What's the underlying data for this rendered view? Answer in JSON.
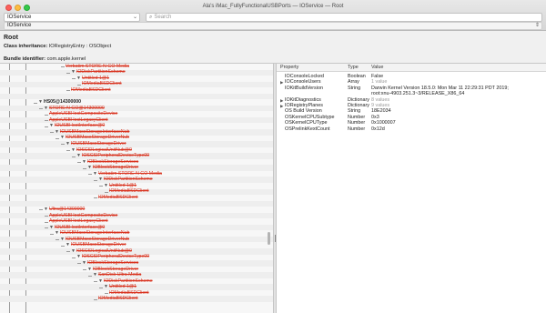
{
  "window": {
    "title": "Ala's iMac_FullyFunctionalUSBPorts — IOService — Root"
  },
  "toolbar": {
    "class_select": "IOService",
    "search_placeholder": "Search",
    "path_select": "IOService"
  },
  "info": {
    "name": "Root",
    "class_inheritance_label": "Class inheritance:",
    "class_inheritance_value": "IORegistryEntry : OSObject",
    "bundle_label": "Bundle identifier:",
    "bundle_value": "com.apple.kernel"
  },
  "tree": [
    {
      "label": "Verbatim STORE N GO Media",
      "depth": 7,
      "tri": "",
      "state": "removed"
    },
    {
      "label": "IODiskPartitionScheme",
      "depth": 8,
      "tri": "▼",
      "state": "removed"
    },
    {
      "label": "Untitled 1@1",
      "depth": 9,
      "tri": "▼",
      "state": "removed"
    },
    {
      "label": "IOMediaBSDClient",
      "depth": 10,
      "tri": "",
      "state": "removed"
    },
    {
      "label": "IOMediaBSDClient",
      "depth": 8,
      "tri": "",
      "state": "removed"
    },
    {
      "label": "",
      "depth": 0,
      "tri": "",
      "state": "blank"
    },
    {
      "label": "HS05@14300000",
      "depth": 2,
      "tri": "▼",
      "state": "ok"
    },
    {
      "label": "STORE N GO@14300000",
      "depth": 3,
      "tri": "▼",
      "state": "removed"
    },
    {
      "label": "AppleUSBHostCompositeDevice",
      "depth": 4,
      "tri": "",
      "state": "removed"
    },
    {
      "label": "AppleUSBHostLegacyClient",
      "depth": 4,
      "tri": "",
      "state": "removed"
    },
    {
      "label": "IOUSBHostInterface@0",
      "depth": 4,
      "tri": "▼",
      "state": "removed"
    },
    {
      "label": "IOUSBMassStorageInterfaceNub",
      "depth": 5,
      "tri": "▼",
      "state": "removed"
    },
    {
      "label": "IOUSBMassStorageDriverNub",
      "depth": 6,
      "tri": "▼",
      "state": "removed"
    },
    {
      "label": "IOUSBMassStorageDriver",
      "depth": 7,
      "tri": "▼",
      "state": "removed"
    },
    {
      "label": "IOSCSILogicalUnitNub@0",
      "depth": 8,
      "tri": "▼",
      "state": "removed"
    },
    {
      "label": "IOSCSIPeripheralDeviceType00",
      "depth": 9,
      "tri": "▼",
      "state": "removed"
    },
    {
      "label": "IOBlockStorageServices",
      "depth": 10,
      "tri": "▼",
      "state": "removed"
    },
    {
      "label": "IOBlockStorageDriver",
      "depth": 11,
      "tri": "▼",
      "state": "removed"
    },
    {
      "label": "Verbatim STORE N GO Media",
      "depth": 12,
      "tri": "▼",
      "state": "removed"
    },
    {
      "label": "IODiskPartitionScheme",
      "depth": 13,
      "tri": "▼",
      "state": "removed"
    },
    {
      "label": "Untitled 1@1",
      "depth": 14,
      "tri": "▼",
      "state": "removed"
    },
    {
      "label": "IOMediaBSDClient",
      "depth": 15,
      "tri": "",
      "state": "removed"
    },
    {
      "label": "IOMediaBSDClient",
      "depth": 13,
      "tri": "",
      "state": "removed"
    },
    {
      "label": "",
      "depth": 0,
      "tri": "",
      "state": "blank"
    },
    {
      "label": "Ultra@14300000",
      "depth": 3,
      "tri": "▼",
      "state": "removed"
    },
    {
      "label": "AppleUSBHostCompositeDevice",
      "depth": 4,
      "tri": "",
      "state": "removed"
    },
    {
      "label": "AppleUSBHostLegacyClient",
      "depth": 4,
      "tri": "",
      "state": "removed"
    },
    {
      "label": "IOUSBHostInterface@0",
      "depth": 4,
      "tri": "▼",
      "state": "removed"
    },
    {
      "label": "IOUSBMassStorageInterfaceNub",
      "depth": 5,
      "tri": "▼",
      "state": "removed"
    },
    {
      "label": "IOUSBMassStorageDriverNub",
      "depth": 6,
      "tri": "▼",
      "state": "removed"
    },
    {
      "label": "IOUSBMassStorageDriver",
      "depth": 7,
      "tri": "▼",
      "state": "removed"
    },
    {
      "label": "IOSCSILogicalUnitNub@0",
      "depth": 8,
      "tri": "▼",
      "state": "removed"
    },
    {
      "label": "IOSCSIPeripheralDeviceType00",
      "depth": 9,
      "tri": "▼",
      "state": "removed"
    },
    {
      "label": "IOBlockStorageServices",
      "depth": 10,
      "tri": "▼",
      "state": "removed"
    },
    {
      "label": "IOBlockStorageDriver",
      "depth": 11,
      "tri": "▼",
      "state": "removed"
    },
    {
      "label": "SanDisk Ultra Media",
      "depth": 12,
      "tri": "▼",
      "state": "removed"
    },
    {
      "label": "IODiskPartitionScheme",
      "depth": 13,
      "tri": "▼",
      "state": "removed"
    },
    {
      "label": "Untitled 1@1",
      "depth": 14,
      "tri": "▼",
      "state": "removed"
    },
    {
      "label": "IOMediaBSDClient",
      "depth": 15,
      "tri": "",
      "state": "removed"
    },
    {
      "label": "IOMediaBSDClient",
      "depth": 13,
      "tri": "",
      "state": "removed"
    }
  ],
  "properties": {
    "headers": {
      "property": "Property",
      "type": "Type",
      "value": "Value"
    },
    "rows": [
      {
        "key": "IOConsoleLocked",
        "type": "Boolean",
        "value": "False",
        "tri": "",
        "dim": false
      },
      {
        "key": "IOConsoleUsers",
        "type": "Array",
        "value": "1 value",
        "tri": "▶",
        "dim": true
      },
      {
        "key": "IOKitBuildVersion",
        "type": "String",
        "value": "Darwin Kernel Version 18.5.0: Mon Mar 11 22:29:31 PDT 2019;",
        "tri": "",
        "dim": false
      },
      {
        "key": "",
        "type": "",
        "value": "root:xnu-4903.251.3~3/RELEASE_X86_64",
        "tri": "",
        "dim": false
      },
      {
        "key": "IOKitDiagnostics",
        "type": "Dictionary",
        "value": "8 values",
        "tri": "▶",
        "dim": true
      },
      {
        "key": "IORegistryPlanes",
        "type": "Dictionary",
        "value": "9 values",
        "tri": "▶",
        "dim": true
      },
      {
        "key": "OS Build Version",
        "type": "String",
        "value": "18E2034",
        "tri": "",
        "dim": false
      },
      {
        "key": "OSKernelCPUSubtype",
        "type": "Number",
        "value": "0x3",
        "tri": "",
        "dim": false
      },
      {
        "key": "OSKernelCPUType",
        "type": "Number",
        "value": "0x1000007",
        "tri": "",
        "dim": false
      },
      {
        "key": "OSPrelinkKextCount",
        "type": "Number",
        "value": "0x12d",
        "tri": "",
        "dim": false
      }
    ]
  }
}
